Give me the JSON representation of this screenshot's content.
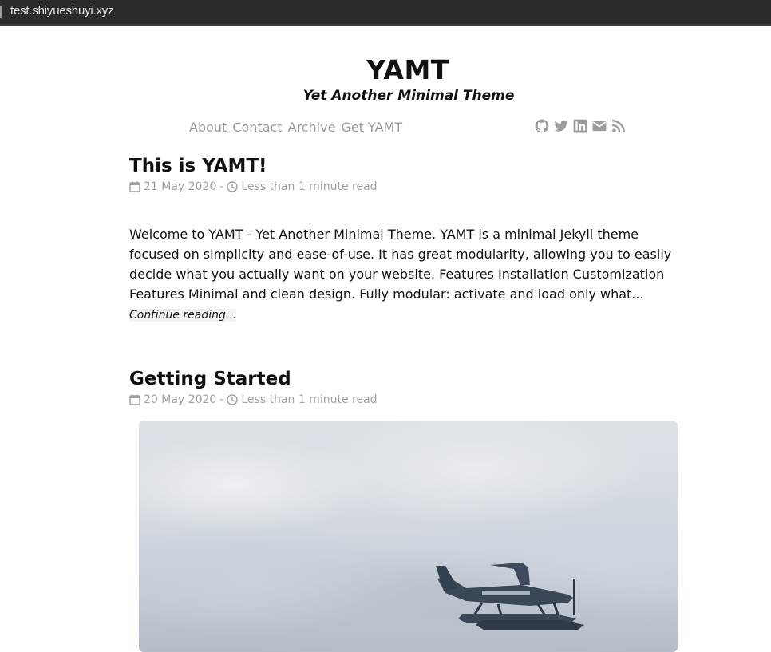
{
  "browser": {
    "url": "test.shiyueshuyi.xyz"
  },
  "site": {
    "title": "YAMT",
    "tagline": "Yet Another Minimal Theme"
  },
  "nav": [
    "About",
    "Contact",
    "Archive",
    "Get YAMT"
  ],
  "social_icons": [
    "github-icon",
    "twitter-icon",
    "linkedin-icon",
    "email-icon",
    "rss-icon"
  ],
  "posts": [
    {
      "title": "This is YAMT!",
      "date": "21 May 2020",
      "separator": "-",
      "read_time": "Less than 1 minute read",
      "excerpt": "Welcome to YAMT - Yet Another Minimal Theme. YAMT is a minimal Jekyll theme focused on simplicity and ease-of-use. It has great modularity, allowing you to easily decide what you actually want on your website. Features Installation Customization Features Minimal and clean design. Fully modular: activate and load only what...",
      "continue_label": "Continue reading..."
    },
    {
      "title": "Getting Started",
      "date": "20 May 2020",
      "separator": "-",
      "read_time": "Less than 1 minute read"
    }
  ],
  "colors": {
    "addressbar": "#2b2b2b",
    "muted_text": "#9b9b9b",
    "text": "#111111"
  }
}
